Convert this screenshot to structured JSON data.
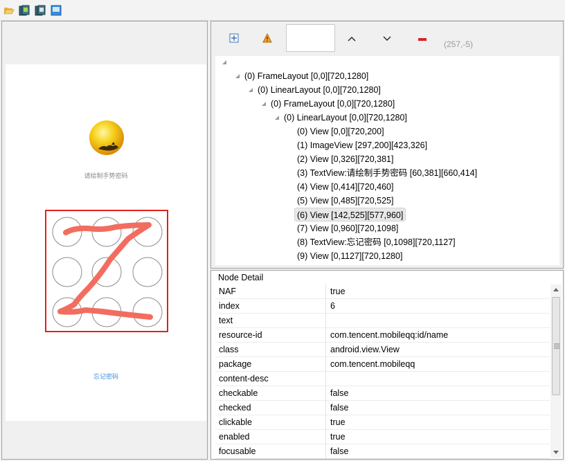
{
  "toolbar": {
    "icons": [
      "open-folder-icon",
      "device-screenshot-icon",
      "device-screenshot-compressed-icon",
      "save-icon"
    ]
  },
  "device": {
    "hint": "请绘制手势密码",
    "forgot": "忘记密码"
  },
  "hierarchy_toolbar": {
    "icons": [
      "expand-all-icon",
      "warning-icon",
      "arrow-up-icon",
      "arrow-down-icon",
      "minus-icon"
    ],
    "coords": "(257,-5)"
  },
  "tree": {
    "nodes": [
      {
        "label": "(0) FrameLayout [0,0][720,1280]",
        "depth": 0,
        "expandable": true
      },
      {
        "label": "(0) LinearLayout [0,0][720,1280]",
        "depth": 1,
        "expandable": true
      },
      {
        "label": "(0) FrameLayout [0,0][720,1280]",
        "depth": 2,
        "expandable": true
      },
      {
        "label": "(0) LinearLayout [0,0][720,1280]",
        "depth": 3,
        "expandable": true
      },
      {
        "label": "(0) View [0,0][720,200]",
        "depth": 4,
        "expandable": false
      },
      {
        "label": "(1) ImageView [297,200][423,326]",
        "depth": 4,
        "expandable": false
      },
      {
        "label": "(2) View [0,326][720,381]",
        "depth": 4,
        "expandable": false
      },
      {
        "label": "(3) TextView:请绘制手势密码 [60,381][660,414]",
        "depth": 4,
        "expandable": false
      },
      {
        "label": "(4) View [0,414][720,460]",
        "depth": 4,
        "expandable": false
      },
      {
        "label": "(5) View [0,485][720,525]",
        "depth": 4,
        "expandable": false
      },
      {
        "label": "(6) View [142,525][577,960]",
        "depth": 4,
        "expandable": false,
        "selected": true
      },
      {
        "label": "(7) View [0,960][720,1098]",
        "depth": 4,
        "expandable": false
      },
      {
        "label": "(8) TextView:忘记密码 [0,1098][720,1127]",
        "depth": 4,
        "expandable": false
      },
      {
        "label": "(9) View [0,1127][720,1280]",
        "depth": 4,
        "expandable": false
      }
    ]
  },
  "node_detail": {
    "title": "Node Detail",
    "rows": [
      {
        "key": "NAF",
        "value": "true"
      },
      {
        "key": "index",
        "value": "6"
      },
      {
        "key": "text",
        "value": ""
      },
      {
        "key": "resource-id",
        "value": "com.tencent.mobileqq:id/name"
      },
      {
        "key": "class",
        "value": "android.view.View"
      },
      {
        "key": "package",
        "value": "com.tencent.mobileqq"
      },
      {
        "key": "content-desc",
        "value": ""
      },
      {
        "key": "checkable",
        "value": "false"
      },
      {
        "key": "checked",
        "value": "false"
      },
      {
        "key": "clickable",
        "value": "true"
      },
      {
        "key": "enabled",
        "value": "true"
      },
      {
        "key": "focusable",
        "value": "false"
      }
    ]
  },
  "colors": {
    "pattern_stroke": "#f26d5f",
    "selection_box": "#e0201c",
    "forgot_link": "#3b8fd8"
  }
}
